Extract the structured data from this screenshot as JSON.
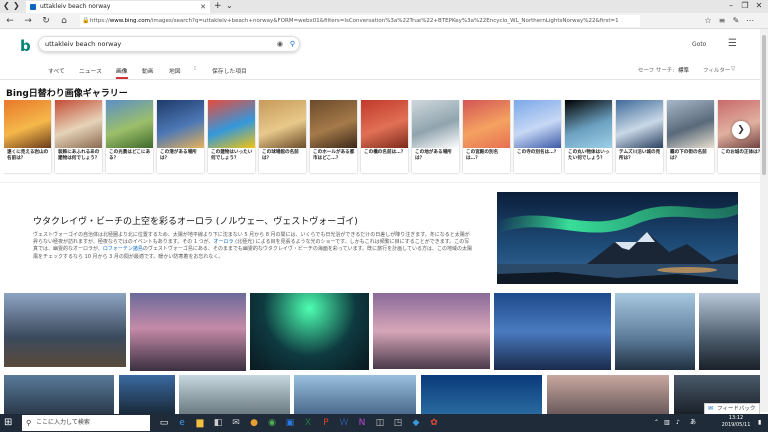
{
  "browser": {
    "tab_title": "uttakleiv beach norway",
    "new_tab": "+",
    "tab_menu": "⌄",
    "tab_back": "❮",
    "tab_fwd": "❯",
    "url_prefix": "https://",
    "url_host": "www.bing.com",
    "url_rest": "/images/search?q=uttakleiv+beach+norway&FORM=webx01&filters=IsConversation%3a%22True%22+BTEPKey%3a%22Encyclo_WL_NorthernLightsNorway%22&first=1"
  },
  "bing": {
    "search_value": "uttakleiv beach norway",
    "signin": "Goto",
    "scopes": [
      "すべて",
      "ニュース",
      "画像",
      "動画",
      "地図",
      "⁝",
      "保存した項目"
    ],
    "active_scope": "画像",
    "safesearch_label": "セーフ サーチ:",
    "safesearch_value": "標準",
    "filter_label": "フィルター"
  },
  "gallery": {
    "title": "Bing日替わり画像ギャラリー",
    "cards": [
      {
        "caption": "遠くに見える岩山の名前は？",
        "colors": [
          "#e8782a",
          "#f5b84a",
          "#6a3b1a"
        ]
      },
      {
        "caption": "装飾にあふれるあの建物は何でしょう？",
        "colors": [
          "#c44b35",
          "#e6d3b8",
          "#8a6a50"
        ]
      },
      {
        "caption": "この光景はどこにある？",
        "colors": [
          "#5a8fc7",
          "#9cbf6a",
          "#3f6a2c"
        ]
      },
      {
        "caption": "この港がある場所は？",
        "colors": [
          "#1e3a6a",
          "#4d78b5",
          "#e6b35a"
        ]
      },
      {
        "caption": "この建物はいったい何でしょう？",
        "colors": [
          "#e74c3c",
          "#3498db",
          "#f1c40f"
        ]
      },
      {
        "caption": "この球場館の名前は？",
        "colors": [
          "#c69a5a",
          "#e8c98a",
          "#6a4a2a"
        ]
      },
      {
        "caption": "このホールがある都市はどこ…？",
        "colors": [
          "#6b4a2a",
          "#a57a4a",
          "#3a2818"
        ]
      },
      {
        "caption": "この橋の名前は…？",
        "colors": [
          "#c0392b",
          "#e17055",
          "#7b2a1a"
        ]
      },
      {
        "caption": "この地がある場所は？",
        "colors": [
          "#cfd8dc",
          "#90a4ae",
          "#ffffff"
        ]
      },
      {
        "caption": "この宮殿の別名は…？",
        "colors": [
          "#d35454",
          "#f4a261",
          "#e76f51"
        ]
      },
      {
        "caption": "この寺の別名は…？",
        "colors": [
          "#7aa7e8",
          "#c7d8f5",
          "#3a5aa8"
        ]
      },
      {
        "caption": "この丸い物体はいったい何でしょう？",
        "colors": [
          "#000000",
          "#6ca0c0",
          "#9cd0e8"
        ]
      },
      {
        "caption": "テムズ川沿い城の見所は？",
        "colors": [
          "#3e6a9a",
          "#c9d8e6",
          "#2a4060"
        ]
      },
      {
        "caption": "霧の下の街の名前は？",
        "colors": [
          "#a8b8c8",
          "#5a6a7a",
          "#e8e0d0"
        ]
      },
      {
        "caption": "このお城の正体は？",
        "colors": [
          "#c96a6a",
          "#e0b0a0",
          "#6a3a3a"
        ]
      }
    ],
    "next": "❯"
  },
  "feature": {
    "title": "ウタクレイヴ・ビーチの上空を彩るオーロラ (ノルウェー、ヴェストヴォーゴイ)",
    "p1": "ヴェストヴォーゴイの自治体は北極圏より北に位置するため、太陽が地平線より下に沈まない 5 月から 8 月の間には、いくらでも日光浴ができるだけの日差しが降り注ぎます。冬になると太陽が昇らない極夜が訪れますが、極夜ならではのイベントもあります。その 1 つが、",
    "link1": "オーロラ",
    "p2": " (北極光) による目を見張るような光のショーです。しかもこれは頻繁に目にすることができます。この写真では、幽霊的なオーロラが、",
    "link2": "ロフォーテン諸島",
    "p3": "のヴェストヴォーゴ島にある、そのままでも幽霊的なウタクレイヴ・ビーチの海面を彩っています。既に旅行を計画している方は、この地域の太陽風をチェックするなら 10 月から 3 月の間が最適です。暖かい防寒着をお忘れなく。"
  },
  "feedback": "フィードバック",
  "taskbar": {
    "search_placeholder": "ここに入力して検索",
    "time": "13:12",
    "date": "2019/05/11",
    "lang": "あ"
  }
}
